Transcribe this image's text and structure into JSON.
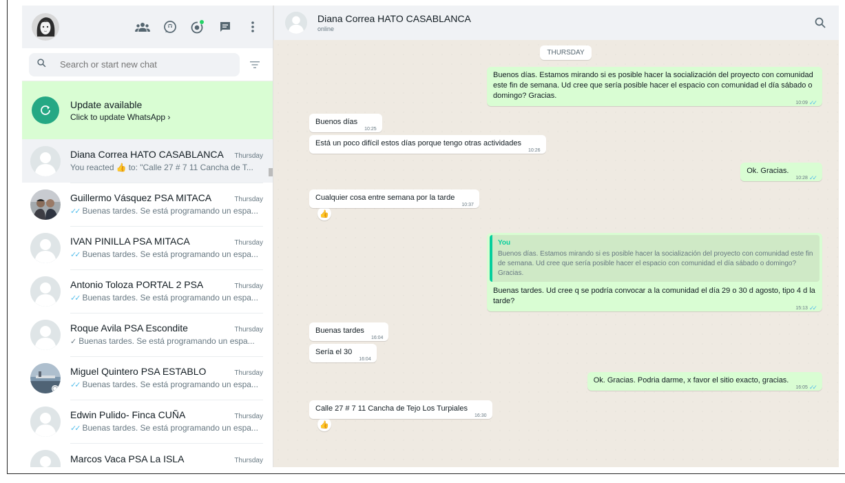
{
  "sidebar": {
    "search_placeholder": "Search or start new chat",
    "update": {
      "title": "Update available",
      "subtitle": "Click to update WhatsApp ›"
    },
    "chats": [
      {
        "name": "Diana Correa HATO CASABLANCA",
        "time": "Thursday",
        "preview_pre": "You reacted",
        "preview_post": "to: \"Calle 27 # 7 11 Cancha de T...",
        "reaction": "👍",
        "active": true
      },
      {
        "name": "Guillermo Vásquez PSA MITACA",
        "time": "Thursday",
        "preview": "Buenas tardes. Se está programando un espa...",
        "ticks": "double",
        "photo": true
      },
      {
        "name": "IVAN PINILLA PSA MITACA",
        "time": "Thursday",
        "preview": "Buenas tardes. Se está programando un espa...",
        "ticks": "double"
      },
      {
        "name": "Antonio Toloza PORTAL 2 PSA",
        "time": "Thursday",
        "preview": "Buenas tardes. Se está programando un espa...",
        "ticks": "double"
      },
      {
        "name": "Roque Avila PSA Escondite",
        "time": "Thursday",
        "preview": "Buenas tardes. Se está programando un espa...",
        "ticks": "single"
      },
      {
        "name": "Miguel Quintero PSA ESTABLO",
        "time": "Thursday",
        "preview": "Buenas tardes. Se está programando un espa...",
        "ticks": "double",
        "photo": true
      },
      {
        "name": "Edwin Pulido- Finca CUÑA",
        "time": "Thursday",
        "preview": "Buenas tardes. Se está programando un espa...",
        "ticks": "double"
      },
      {
        "name": "Marcos Vaca PSA La ISLA",
        "time": "Thursday",
        "preview": "",
        "ticks": "double"
      }
    ]
  },
  "chat": {
    "contact_name": "Diana Correa HATO CASABLANCA",
    "contact_status": "online",
    "day_label": "THURSDAY",
    "m1": {
      "text": "Buenos días. Estamos mirando si es posible hacer la socialización del proyecto con comunidad este fin de semana. Ud cree que sería posible hacer el espacio con comunidad el día sábado o domingo? Gracias.",
      "time": "10:09"
    },
    "m2": {
      "text": "Buenos días",
      "time": "10:25"
    },
    "m3": {
      "text": "Está un poco difícil estos días porque tengo otras actividades",
      "time": "10:26"
    },
    "m4": {
      "text": "Ok. Gracias.",
      "time": "10:28"
    },
    "m5": {
      "text": "Cualquier cosa entre semana por la tarde",
      "time": "10:37",
      "reaction": "👍"
    },
    "m6": {
      "quote_author": "You",
      "quote_text": "Buenos días. Estamos mirando si es posible hacer la socialización del proyecto con comunidad este fin de semana. Ud cree que sería posible hacer el espacio con comunidad el día sábado o domingo? Gracias.",
      "text": "Buenas tardes. Ud cree q se podría convocar a la comunidad el día 29 o 30 d agosto, tipo 4 d la tarde?",
      "time": "15:13"
    },
    "m7": {
      "text": "Buenas tardes",
      "time": "16:04"
    },
    "m8": {
      "text": "Sería el 30",
      "time": "16:04"
    },
    "m9": {
      "text": "Ok. Gracias. Podria darme, x favor el sitio exacto, gracias.",
      "time": "16:05"
    },
    "m10": {
      "text": "Calle 27 # 7 11 Cancha de Tejo Los Turpiales",
      "time": "16:30",
      "reaction": "👍"
    }
  },
  "colors": {
    "accent": "#25a884",
    "outgoing_bubble": "#d9fdd3",
    "read_ticks": "#53bdeb",
    "chat_bg": "#efeae2"
  },
  "icons": [
    "communities-icon",
    "status-icon",
    "channels-icon",
    "new-chat-icon",
    "menu-icon",
    "search-icon",
    "filter-icon",
    "refresh-icon"
  ]
}
